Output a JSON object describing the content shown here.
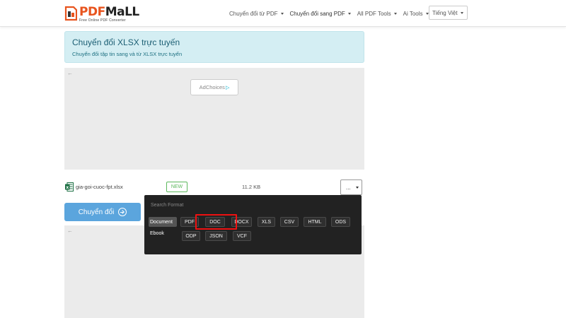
{
  "logo": {
    "brand_pdf": "PDF",
    "brand_mall": "MaLL",
    "tagline": "Free Online PDF Converter"
  },
  "nav": {
    "items": [
      {
        "label": "Chuyển đổi từ PDF"
      },
      {
        "label": "Chuyển đổi sang PDF"
      },
      {
        "label": "All PDF Tools"
      },
      {
        "label": "Ai Tools"
      }
    ],
    "language": "Tiếng Việt"
  },
  "banner": {
    "title": "Chuyển đổi XLSX trực tuyến",
    "subtitle": "Chuyển đổi tập tin sang và từ XLSX trực tuyến"
  },
  "ad": {
    "choices_label": "AdChoices",
    "back_arrow": "←"
  },
  "file": {
    "name": "gia-goi-cuoc-fpt.xlsx",
    "badge": "NEW",
    "size": "11.2 KB",
    "format_value": "..."
  },
  "convert_button": {
    "label": "Chuyển đổi"
  },
  "format_dropdown": {
    "search_placeholder": "Search Format",
    "categories": [
      {
        "label": "Document",
        "active": true
      },
      {
        "label": "Ebook",
        "active": false
      }
    ],
    "formats_row1": [
      "PDF",
      "DOC",
      "DOCX",
      "XLS",
      "CSV",
      "HTML",
      "ODS"
    ],
    "formats_row2": [
      "ODP",
      "JSON",
      "VCF"
    ],
    "highlighted": "DOC"
  },
  "colors": {
    "brand_orange": "#e8541e",
    "banner_bg": "#d4eef3",
    "button_blue": "#5ba5dd",
    "badge_green": "#5cb85c",
    "dropdown_bg": "#222222",
    "highlight_red": "#ee1111"
  }
}
